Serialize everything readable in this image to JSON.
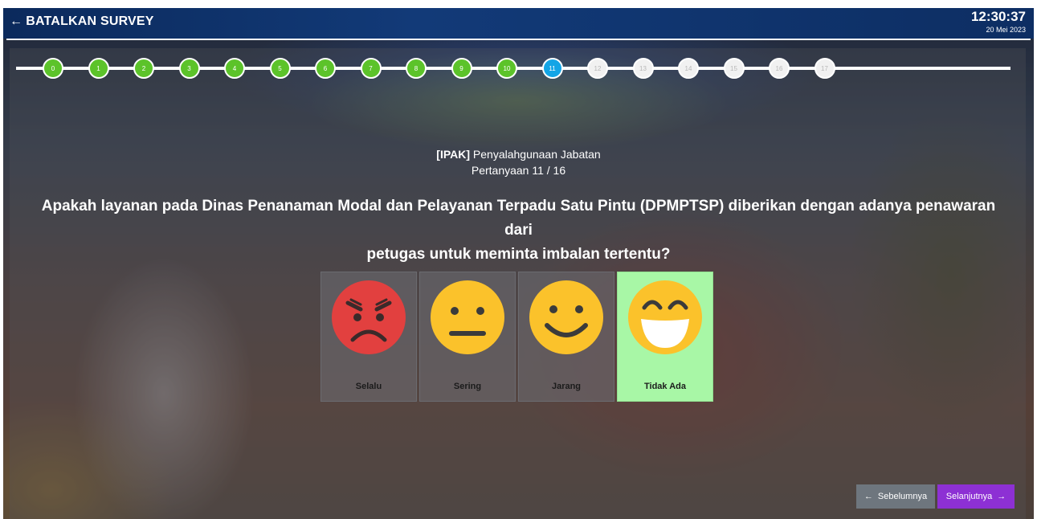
{
  "header": {
    "back_label": "BATALKAN SURVEY",
    "time": "12:30:37",
    "date": "20 Mei 2023"
  },
  "stepper": {
    "steps": [
      "0",
      "1",
      "2",
      "3",
      "4",
      "5",
      "6",
      "7",
      "8",
      "9",
      "10",
      "11",
      "12",
      "13",
      "14",
      "15",
      "16",
      "17"
    ],
    "current_index": 11,
    "colors": {
      "done": "#5cc32a",
      "current": "#13a5e6",
      "todo": "#f1f1f1"
    }
  },
  "question": {
    "category_tag": "[IPAK]",
    "category": "Penyalahgunaan Jabatan",
    "counter": "Pertanyaan 11 / 16",
    "text_line1": "Apakah layanan pada Dinas Penanaman Modal dan Pelayanan Terpadu Satu Pintu (DPMPTSP) diberikan dengan adanya penawaran dari",
    "text_line2": "petugas untuk meminta imbalan tertentu?"
  },
  "options": [
    {
      "label": "Selalu",
      "icon": "angry-face-icon",
      "selected": false
    },
    {
      "label": "Sering",
      "icon": "neutral-face-icon",
      "selected": false
    },
    {
      "label": "Jarang",
      "icon": "slight-smile-face-icon",
      "selected": false
    },
    {
      "label": "Tidak Ada",
      "icon": "grinning-face-icon",
      "selected": true
    }
  ],
  "nav": {
    "prev_label": "Sebelumnya",
    "next_label": "Selanjutnya",
    "prev_color": "#6e767e",
    "next_color": "#8d30d4"
  }
}
